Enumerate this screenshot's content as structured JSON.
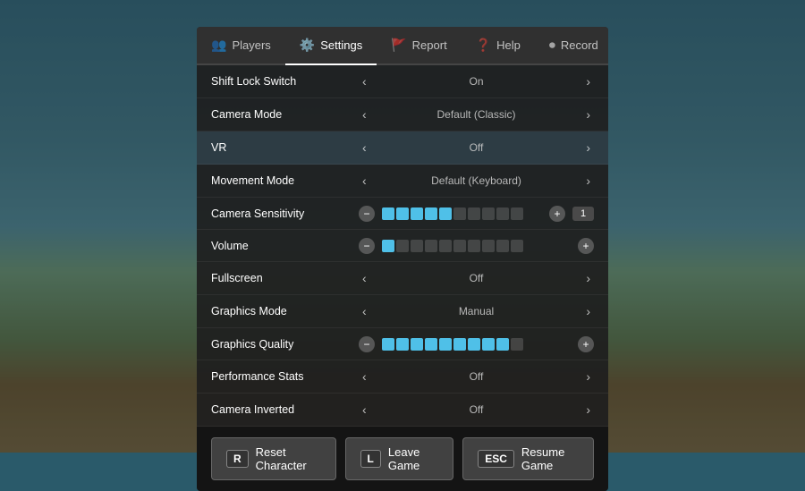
{
  "background": {
    "color_top": "#4a8fa8",
    "color_bottom": "#9a8a60"
  },
  "tabs": [
    {
      "id": "players",
      "label": "Players",
      "icon": "👥",
      "active": false
    },
    {
      "id": "settings",
      "label": "Settings",
      "icon": "⚙️",
      "active": true
    },
    {
      "id": "report",
      "label": "Report",
      "icon": "🚩",
      "active": false
    },
    {
      "id": "help",
      "label": "Help",
      "icon": "❓",
      "active": false
    },
    {
      "id": "record",
      "label": "Record",
      "icon": "⏺",
      "active": false
    }
  ],
  "settings": [
    {
      "id": "shift-lock",
      "label": "Shift Lock Switch",
      "type": "toggle",
      "value": "On",
      "highlighted": false
    },
    {
      "id": "camera-mode",
      "label": "Camera Mode",
      "type": "toggle",
      "value": "Default (Classic)",
      "highlighted": false
    },
    {
      "id": "vr",
      "label": "VR",
      "type": "toggle",
      "value": "Off",
      "highlighted": true
    },
    {
      "id": "movement-mode",
      "label": "Movement Mode",
      "type": "toggle",
      "value": "Default (Keyboard)",
      "highlighted": false
    },
    {
      "id": "camera-sensitivity",
      "label": "Camera Sensitivity",
      "type": "slider",
      "filled": 5,
      "total": 10,
      "sliderValue": "1",
      "highlighted": false
    },
    {
      "id": "volume",
      "label": "Volume",
      "type": "slider",
      "filled": 1,
      "total": 10,
      "sliderValue": null,
      "highlighted": false
    },
    {
      "id": "fullscreen",
      "label": "Fullscreen",
      "type": "toggle",
      "value": "Off",
      "highlighted": false
    },
    {
      "id": "graphics-mode",
      "label": "Graphics Mode",
      "type": "toggle",
      "value": "Manual",
      "highlighted": false
    },
    {
      "id": "graphics-quality",
      "label": "Graphics Quality",
      "type": "slider",
      "filled": 9,
      "total": 10,
      "sliderValue": null,
      "highlighted": false
    },
    {
      "id": "performance-stats",
      "label": "Performance Stats",
      "type": "toggle",
      "value": "Off",
      "highlighted": false
    },
    {
      "id": "camera-inverted",
      "label": "Camera Inverted",
      "type": "toggle",
      "value": "Off",
      "highlighted": false
    }
  ],
  "buttons": [
    {
      "id": "reset",
      "key": "R",
      "label": "Reset Character"
    },
    {
      "id": "leave",
      "key": "L",
      "label": "Leave Game"
    },
    {
      "id": "resume",
      "key": "ESC",
      "label": "Resume Game"
    }
  ]
}
